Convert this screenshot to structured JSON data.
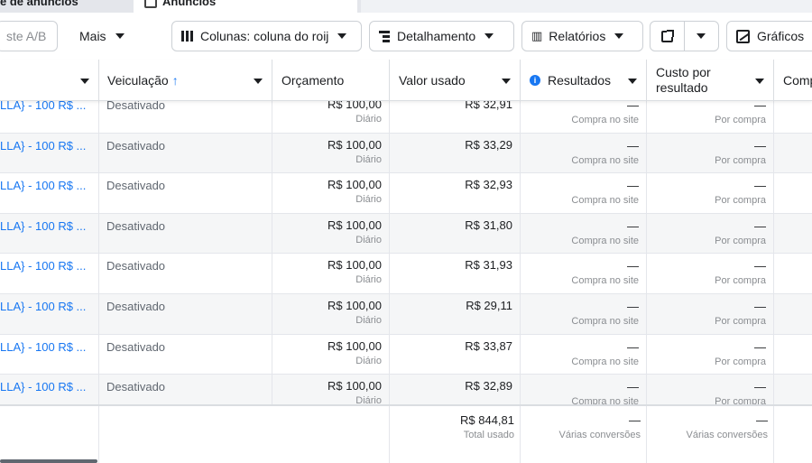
{
  "tabs": {
    "left": "e de anúncios",
    "middle": "Anúncios"
  },
  "toolbar": {
    "ab_test": "ste A/B",
    "more": "Mais",
    "columns": "Colunas: coluna do roij",
    "breakdown": "Detalhamento",
    "reports": "Relatórios",
    "charts": "Gráficos"
  },
  "headers": {
    "name": "",
    "delivery": "Veiculação",
    "delivery_sort": "↑",
    "budget": "Orçamento",
    "amount_spent": "Valor usado",
    "results": "Resultados",
    "cost_per_result_1": "Custo por",
    "cost_per_result_2": "resultado",
    "next": "Comp"
  },
  "rows": [
    {
      "name": "LLA} - 100 R$ ...",
      "status": "Desativado",
      "budget": "R$ 100,00",
      "budget_type": "Diário",
      "spent": "R$ 32,91",
      "result": "—",
      "result_type": "Compra no site",
      "cost": "—",
      "cost_type": "Por compra"
    },
    {
      "name": "LLA} - 100 R$ ...",
      "status": "Desativado",
      "budget": "R$ 100,00",
      "budget_type": "Diário",
      "spent": "R$ 33,29",
      "result": "—",
      "result_type": "Compra no site",
      "cost": "—",
      "cost_type": "Por compra"
    },
    {
      "name": "LLA} - 100 R$ ...",
      "status": "Desativado",
      "budget": "R$ 100,00",
      "budget_type": "Diário",
      "spent": "R$ 32,93",
      "result": "—",
      "result_type": "Compra no site",
      "cost": "—",
      "cost_type": "Por compra"
    },
    {
      "name": "LLA} - 100 R$ ...",
      "status": "Desativado",
      "budget": "R$ 100,00",
      "budget_type": "Diário",
      "spent": "R$ 31,80",
      "result": "—",
      "result_type": "Compra no site",
      "cost": "—",
      "cost_type": "Por compra"
    },
    {
      "name": "LLA} - 100 R$ ...",
      "status": "Desativado",
      "budget": "R$ 100,00",
      "budget_type": "Diário",
      "spent": "R$ 31,93",
      "result": "—",
      "result_type": "Compra no site",
      "cost": "—",
      "cost_type": "Por compra"
    },
    {
      "name": "LLA} - 100 R$ ...",
      "status": "Desativado",
      "budget": "R$ 100,00",
      "budget_type": "Diário",
      "spent": "R$ 29,11",
      "result": "—",
      "result_type": "Compra no site",
      "cost": "—",
      "cost_type": "Por compra"
    },
    {
      "name": "LLA} - 100 R$ ...",
      "status": "Desativado",
      "budget": "R$ 100,00",
      "budget_type": "Diário",
      "spent": "R$ 33,87",
      "result": "—",
      "result_type": "Compra no site",
      "cost": "—",
      "cost_type": "Por compra"
    },
    {
      "name": "LLA} - 100 R$ ...",
      "status": "Desativado",
      "budget": "R$ 100,00",
      "budget_type": "Diário",
      "spent": "R$ 32,89",
      "result": "—",
      "result_type": "Compra no site",
      "cost": "—",
      "cost_type": "Por compra"
    }
  ],
  "totals": {
    "spent": "R$ 844,81",
    "spent_label": "Total usado",
    "result": "—",
    "result_label": "Várias conversões",
    "cost": "—",
    "cost_label": "Várias conversões"
  }
}
